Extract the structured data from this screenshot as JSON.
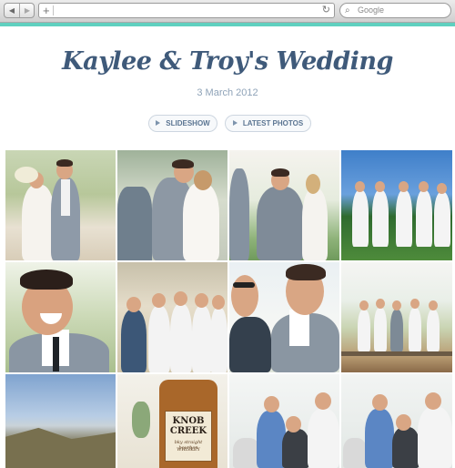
{
  "browser": {
    "back_icon": "chevron-left-icon",
    "forward_icon": "chevron-right-icon",
    "add_icon": "plus-icon",
    "reload_icon": "reload-icon",
    "search_icon": "search-icon",
    "search_placeholder": "Google",
    "accent_color": "#5fd0bf"
  },
  "header": {
    "title": "Kaylee & Troy's Wedding",
    "date": "3 March 2012",
    "title_color": "#3f5a7a"
  },
  "actions": {
    "slideshow_label": "SLIDESHOW",
    "latest_label": "LATEST PHOTOS"
  },
  "gallery": {
    "photos": [
      {
        "subject": "bride and groom walking down aisle"
      },
      {
        "subject": "couple kissing at altar"
      },
      {
        "subject": "groom at altar facing bride"
      },
      {
        "subject": "groomsmen standing on lawn"
      },
      {
        "subject": "groomsman laughing portrait"
      },
      {
        "subject": "groomsmen walking in sunglasses"
      },
      {
        "subject": "groom and groomsman talking"
      },
      {
        "subject": "groomsmen lined up by railing"
      },
      {
        "subject": "hillside landscape view"
      },
      {
        "subject": "whiskey bottle label"
      },
      {
        "subject": "groomsmen group gathering"
      },
      {
        "subject": "groomsmen group gathering"
      }
    ],
    "bottle_brand": "KNOB CREEK",
    "bottle_subtitle": "bky straight bourbon",
    "bottle_subtitle2": "WHISKEY"
  }
}
